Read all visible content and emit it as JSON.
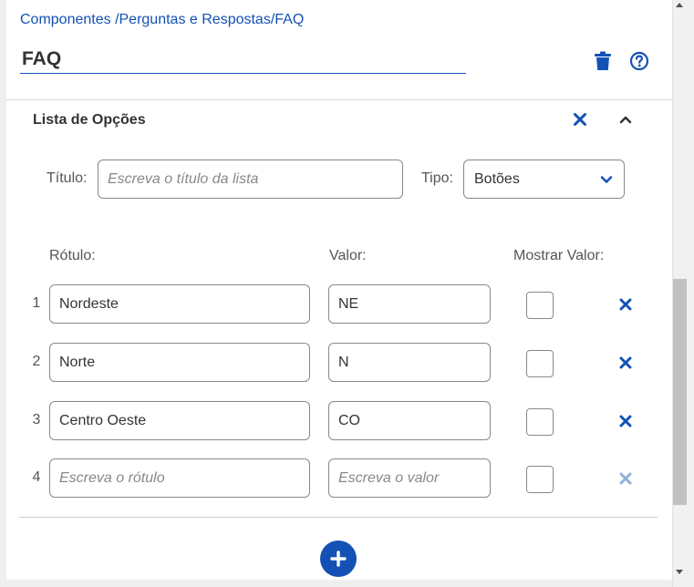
{
  "breadcrumb": "Componentes /Perguntas e Respostas/FAQ",
  "component": {
    "title_value": "FAQ",
    "icons": {
      "delete": "trash-icon",
      "help": "question-circle-icon"
    }
  },
  "section": {
    "title": "Lista de Opções",
    "icons": {
      "close": "close-icon",
      "collapse": "chevron-up-icon"
    }
  },
  "list_settings": {
    "title_label": "Título:",
    "title_placeholder": "Escreva o título da lista",
    "type_label": "Tipo:",
    "type_value": "Botões",
    "type_icon": "chevron-down-icon"
  },
  "columns": {
    "label": "Rótulo:",
    "value": "Valor:",
    "show_value": "Mostrar Valor:"
  },
  "options": [
    {
      "number": "1",
      "label": "Nordeste",
      "value": "NE",
      "show_value": false
    },
    {
      "number": "2",
      "label": "Norte",
      "value": "N",
      "show_value": false
    },
    {
      "number": "3",
      "label": "Centro Oeste",
      "value": "CO",
      "show_value": false
    },
    {
      "number": "4",
      "label": "",
      "value": "",
      "show_value": false
    }
  ],
  "placeholders": {
    "label": "Escreva o rótulo",
    "value": "Escreva o valor"
  },
  "add_icon": "plus-circle-icon",
  "colors": {
    "accent": "#1351b4",
    "accent_disabled": "#8fb0dc",
    "border": "#888888",
    "text": "#333333"
  }
}
